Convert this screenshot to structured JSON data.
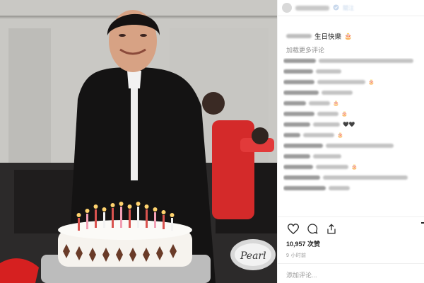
{
  "post": {
    "photo_icon": "birthday-photo",
    "header": {
      "verified": true,
      "follow_label": "關注"
    },
    "caption": {
      "text": "生日快樂",
      "emoji": "🎂"
    },
    "load_more": "加载更多评论",
    "comments": [
      {
        "user_w": 46,
        "text_w": 140,
        "emoji": ""
      },
      {
        "user_w": 42,
        "text_w": 36,
        "emoji": ""
      },
      {
        "user_w": 44,
        "text_w": 68,
        "emoji": "🎂"
      },
      {
        "user_w": 50,
        "text_w": 44,
        "emoji": ""
      },
      {
        "user_w": 32,
        "text_w": 30,
        "emoji": "🎂"
      },
      {
        "user_w": 44,
        "text_w": 30,
        "emoji": "🎂"
      },
      {
        "user_w": 38,
        "text_w": 38,
        "emoji": "🖤🖤"
      },
      {
        "user_w": 24,
        "text_w": 44,
        "emoji": "🎂"
      },
      {
        "user_w": 56,
        "text_w": 96,
        "emoji": ""
      },
      {
        "user_w": 38,
        "text_w": 40,
        "emoji": ""
      },
      {
        "user_w": 42,
        "text_w": 46,
        "emoji": "🎂"
      },
      {
        "user_w": 52,
        "text_w": 120,
        "emoji": ""
      },
      {
        "user_w": 60,
        "text_w": 30,
        "emoji": ""
      }
    ],
    "likes": "10,957 次赞",
    "time": "9 小时前",
    "add_comment_placeholder": "添加评论..."
  },
  "colors": {
    "accent_link": "#3897f0",
    "text": "#262626",
    "muted": "#8e8e8e"
  },
  "icons": [
    "heart-icon",
    "comment-icon",
    "share-icon",
    "bookmark-icon",
    "verified-icon"
  ]
}
